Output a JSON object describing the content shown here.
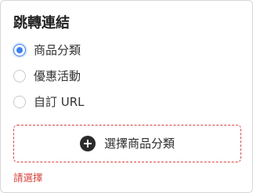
{
  "section": {
    "title": "跳轉連結"
  },
  "radio_group": {
    "selected_index": 0,
    "options": [
      {
        "label": "商品分類",
        "selected": true
      },
      {
        "label": "優惠活動",
        "selected": false
      },
      {
        "label": "自訂 URL",
        "selected": false
      }
    ]
  },
  "select_button": {
    "label": "選擇商品分類",
    "icon": "plus-circle-icon"
  },
  "validation": {
    "error_message": "請選擇"
  },
  "colors": {
    "accent": "#3d7ff0",
    "error": "#d6453d",
    "icon_fill": "#2b2b2b"
  }
}
